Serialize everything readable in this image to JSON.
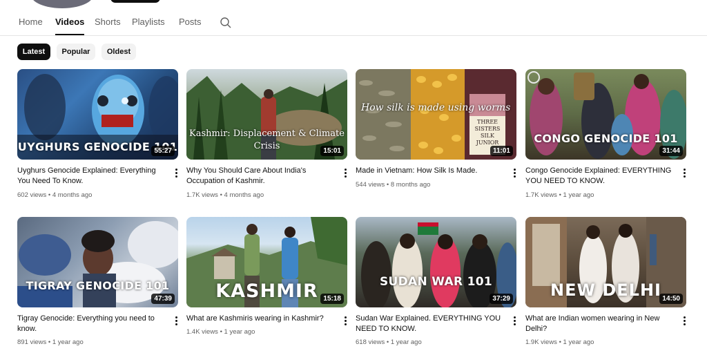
{
  "tabs": [
    {
      "label": "Home",
      "active": false
    },
    {
      "label": "Videos",
      "active": true
    },
    {
      "label": "Shorts",
      "active": false
    },
    {
      "label": "Playlists",
      "active": false
    },
    {
      "label": "Posts",
      "active": false
    }
  ],
  "search_icon": "search-icon",
  "chips": [
    {
      "label": "Latest",
      "active": true
    },
    {
      "label": "Popular",
      "active": false
    },
    {
      "label": "Oldest",
      "active": false
    }
  ],
  "videos": [
    {
      "thumb_text": "UYGHURS GENOCIDE 101",
      "duration": "55:27",
      "title": "Uyghurs Genocide Explained: Everything You Need To Know.",
      "meta": "602 views • 4 months ago"
    },
    {
      "thumb_text": "Kashmir: Displacement & Climate Crisis",
      "duration": "15:01",
      "title": "Why You Should Care About India's Occupation of Kashmir.",
      "meta": "1.7K views • 4 months ago"
    },
    {
      "thumb_text": "How silk is made using worms",
      "sign_text": "THREE SISTERS SILK JUNIOR",
      "duration": "11:01",
      "title": "Made in Vietnam: How Silk Is Made.",
      "meta": "544 views • 8 months ago"
    },
    {
      "thumb_text": "CONGO GENOCIDE 101",
      "duration": "31:44",
      "title": "Congo Genocide Explained: EVERYTHING YOU NEED TO KNOW.",
      "meta": "1.7K views • 1 year ago"
    },
    {
      "thumb_text": "TIGRAY GENOCIDE 101",
      "duration": "47:39",
      "title": "Tigray Genocide: Everything you need to know.",
      "meta": "891 views • 1 year ago"
    },
    {
      "thumb_text": "KASHMIR",
      "duration": "15:18",
      "title": "What are Kashmiris wearing in Kashmir?",
      "meta": "1.4K views • 1 year ago"
    },
    {
      "thumb_text": "SUDAN WAR 101",
      "duration": "37:29",
      "title": "Sudan War Explained. EVERYTHING YOU NEED TO KNOW.",
      "meta": "618 views • 1 year ago"
    },
    {
      "thumb_text": "NEW DELHI",
      "duration": "14:50",
      "title": "What are Indian women wearing in New Delhi?",
      "meta": "1.9K views • 1 year ago"
    }
  ],
  "colors": {
    "active_chip": "#0f0f0f",
    "chip_bg": "#f2f2f2",
    "meta_text": "#606060"
  }
}
